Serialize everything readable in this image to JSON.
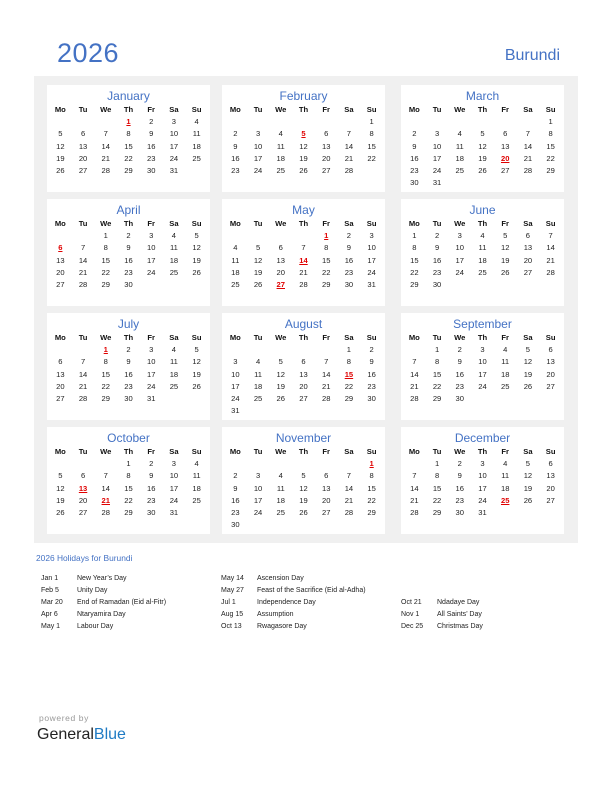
{
  "header": {
    "year": "2026",
    "country": "Burundi"
  },
  "weekdays": [
    "Mo",
    "Tu",
    "We",
    "Th",
    "Fr",
    "Sa",
    "Su"
  ],
  "months": [
    {
      "name": "January",
      "offset": 3,
      "days": 31,
      "holidays": [
        1
      ]
    },
    {
      "name": "February",
      "offset": 6,
      "days": 28,
      "holidays": [
        5
      ]
    },
    {
      "name": "March",
      "offset": 6,
      "days": 31,
      "holidays": [
        20
      ]
    },
    {
      "name": "April",
      "offset": 2,
      "days": 30,
      "holidays": [
        6
      ]
    },
    {
      "name": "May",
      "offset": 4,
      "days": 31,
      "holidays": [
        1,
        14,
        27
      ]
    },
    {
      "name": "June",
      "offset": 0,
      "days": 30,
      "holidays": []
    },
    {
      "name": "July",
      "offset": 2,
      "days": 31,
      "holidays": [
        1
      ]
    },
    {
      "name": "August",
      "offset": 5,
      "days": 31,
      "holidays": [
        15
      ]
    },
    {
      "name": "September",
      "offset": 1,
      "days": 30,
      "holidays": []
    },
    {
      "name": "October",
      "offset": 3,
      "days": 31,
      "holidays": [
        13,
        21
      ]
    },
    {
      "name": "November",
      "offset": 6,
      "days": 30,
      "holidays": [
        1
      ]
    },
    {
      "name": "December",
      "offset": 1,
      "days": 31,
      "holidays": [
        25
      ]
    }
  ],
  "holidays_section": {
    "title": "2026 Holidays for Burundi",
    "columns": [
      [
        {
          "date": "Jan 1",
          "name": "New Year’s Day"
        },
        {
          "date": "Feb 5",
          "name": "Unity Day"
        },
        {
          "date": "Mar 20",
          "name": "End of Ramadan (Eid al-Fitr)"
        },
        {
          "date": "Apr 6",
          "name": "Ntaryamira Day"
        },
        {
          "date": "May 1",
          "name": "Labour Day"
        }
      ],
      [
        {
          "date": "May 14",
          "name": "Ascension Day"
        },
        {
          "date": "May 27",
          "name": "Feast of the Sacrifice (Eid al-Adha)"
        },
        {
          "date": "Jul 1",
          "name": "Independence Day"
        },
        {
          "date": "Aug 15",
          "name": "Assumption"
        },
        {
          "date": "Oct 13",
          "name": "Rwagasore Day"
        }
      ],
      [
        {
          "date": "Oct 21",
          "name": "Ndadaye Day"
        },
        {
          "date": "Nov 1",
          "name": "All Saints’ Day"
        },
        {
          "date": "Dec 25",
          "name": "Christmas Day"
        }
      ]
    ]
  },
  "footer": {
    "powered_by": "powered by",
    "brand_general": "General",
    "brand_blue": "Blue"
  }
}
